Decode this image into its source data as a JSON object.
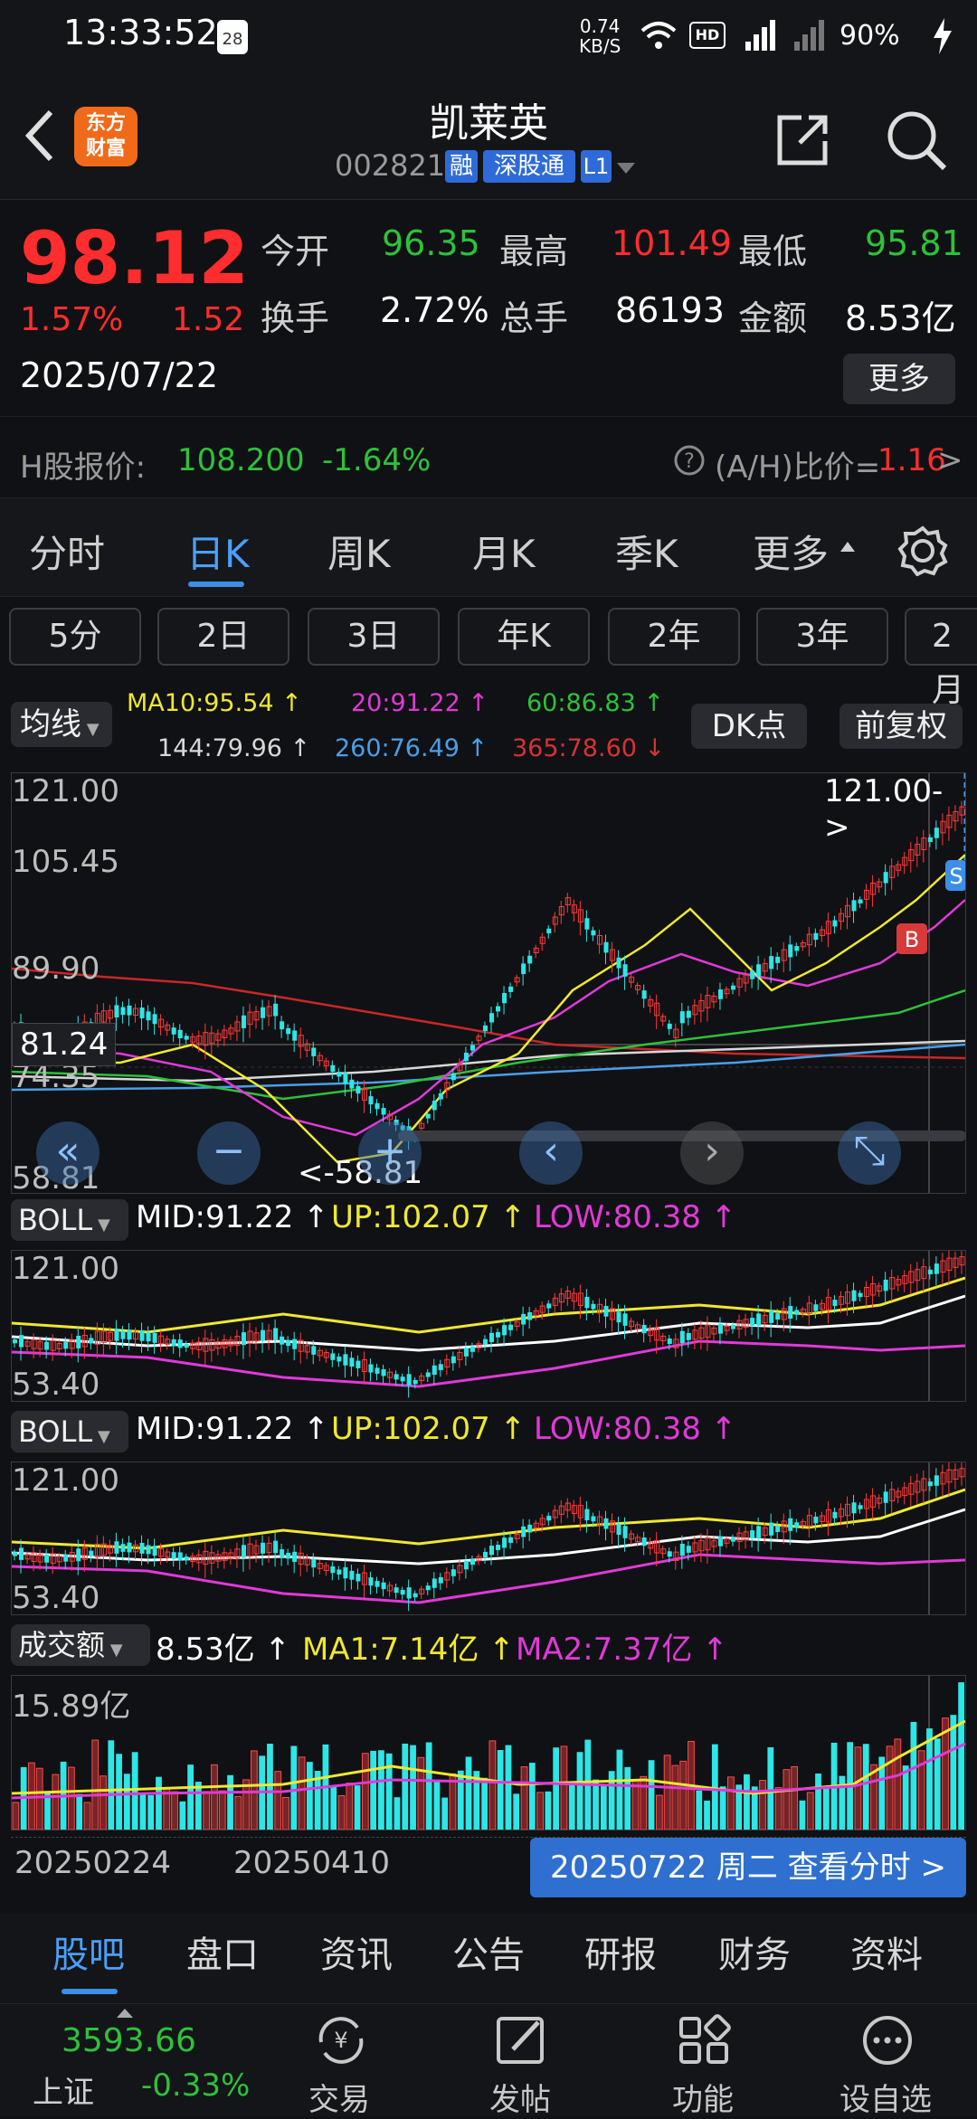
{
  "status_bar": {
    "time": "13:33:52",
    "date_badge": "28",
    "net_speed": "0.74",
    "net_unit": "KB/S",
    "battery": "90%"
  },
  "header": {
    "title": "凯莱英",
    "code": "002821",
    "tags": [
      "融",
      "深股通",
      "L1"
    ],
    "logo_text_line1": "东方",
    "logo_text_line2": "财富"
  },
  "quote": {
    "price": "98.12",
    "change_pct": "1.57%",
    "change": "1.52",
    "date": "2025/07/22",
    "open_label": "今开",
    "open": "96.35",
    "high_label": "最高",
    "high": "101.49",
    "low_label": "最低",
    "low": "95.81",
    "turnover_label": "换手",
    "turnover": "2.72%",
    "volume_label": "总手",
    "volume": "86193",
    "amount_label": "金额",
    "amount": "8.53亿",
    "more_label": "更多"
  },
  "h_share": {
    "label": "H股报价:",
    "price": "108.200",
    "change": "-1.64%",
    "ratio_label": "(A/H)比价=",
    "ratio": "1.16",
    "arrow": ">"
  },
  "ktabs": [
    "分时",
    "日K",
    "周K",
    "月K",
    "季K",
    "更多"
  ],
  "active_ktab": "日K",
  "chips": [
    "5分",
    "2日",
    "3日",
    "年K",
    "2年",
    "3年",
    "2月"
  ],
  "ma": {
    "selector": "均线",
    "ma10": "MA10:95.54",
    "ma20": "20:91.22",
    "ma60": "60:86.83",
    "ma144": "144:79.96",
    "ma260": "260:76.49",
    "ma365": "365:78.60",
    "dk": "DK点",
    "fq": "前复权"
  },
  "main_chart": {
    "y_max": "121.00",
    "y2": "105.45",
    "y3": "89.90",
    "y4": "74.35",
    "y_min": "58.81",
    "crosshair_price": "81.24",
    "max_marker": "121.00->",
    "min_marker": "<-58.81",
    "sell_marker": "S",
    "buy_marker": "B"
  },
  "boll1": {
    "selector": "BOLL",
    "mid": "MID:91.22",
    "up": "UP:102.07",
    "low": "LOW:80.38",
    "y_max": "121.00",
    "y_min": "53.40"
  },
  "boll2": {
    "selector": "BOLL",
    "mid": "MID:91.22",
    "up": "UP:102.07",
    "low": "LOW:80.38",
    "y_max": "121.00",
    "y_min": "53.40"
  },
  "vol": {
    "selector": "成交额",
    "value": "8.53亿",
    "ma1": "MA1:7.14亿",
    "ma2": "MA2:7.37亿",
    "y_max": "15.89亿"
  },
  "x_axis": {
    "d1": "20250224",
    "d2": "20250410",
    "detail": "20250722 周二 查看分时 >"
  },
  "bottom_tabs": [
    "股吧",
    "盘口",
    "资讯",
    "公告",
    "研报",
    "财务",
    "资料"
  ],
  "active_bottom_tab": "股吧",
  "index": {
    "value": "3593.66",
    "name": "上证",
    "change": "-0.33%"
  },
  "bottom_bar": [
    "交易",
    "发帖",
    "功能",
    "设自选"
  ],
  "colors": {
    "up": "#ff2d2d",
    "down": "#2ec13a",
    "yellow": "#f0e830",
    "magenta": "#e03ad8",
    "blue": "#4a9fe8",
    "accent": "#3c8ee8"
  }
}
